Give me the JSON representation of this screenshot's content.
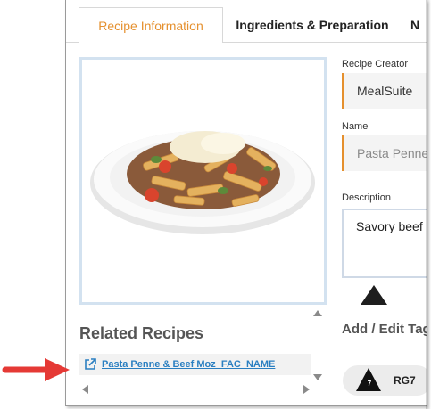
{
  "tabs": [
    {
      "label": "Recipe Information"
    },
    {
      "label": "Ingredients & Preparation"
    },
    {
      "label": "N"
    }
  ],
  "fields": {
    "creator": {
      "label": "Recipe Creator",
      "value": "MealSuite"
    },
    "name": {
      "label": "Name",
      "value": "Pasta Penne"
    },
    "description": {
      "label": "Description",
      "value": "Savory beef"
    }
  },
  "related": {
    "title": "Related Recipes",
    "items": [
      {
        "label": "Pasta Penne & Beef Moz_FAC_NAME"
      }
    ]
  },
  "tags": {
    "title": "Add / Edit Tag",
    "chip": {
      "number": "7",
      "label": "RG7"
    }
  },
  "colors": {
    "accent": "#e5902e",
    "link": "#2a7fc1",
    "annotation_arrow": "#e53935"
  }
}
